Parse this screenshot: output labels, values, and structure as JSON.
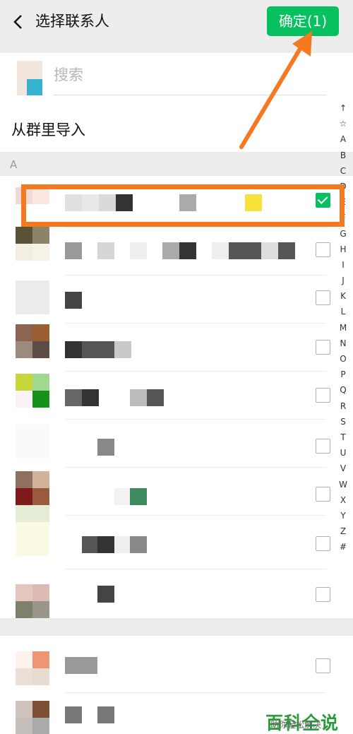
{
  "header": {
    "title": "选择联系人",
    "confirm_label": "确定(1)"
  },
  "search": {
    "placeholder": "搜索"
  },
  "import": {
    "label": "从群里导入"
  },
  "section": {
    "letter": "A"
  },
  "index_letters": [
    "↑",
    "☆",
    "A",
    "B",
    "C",
    "D",
    "E",
    "F",
    "G",
    "H",
    "I",
    "J",
    "K",
    "L",
    "M",
    "N",
    "O",
    "P",
    "Q",
    "R",
    "S",
    "T",
    "U",
    "V",
    "W",
    "X",
    "Y",
    "Z",
    "#"
  ],
  "contacts": [
    {
      "checked": true
    },
    {
      "checked": false
    },
    {
      "checked": false
    },
    {
      "checked": false
    },
    {
      "checked": false
    },
    {
      "checked": false
    },
    {
      "checked": false
    },
    {
      "checked": false
    },
    {
      "checked": false
    },
    {
      "checked": false
    },
    {
      "checked": false
    }
  ],
  "watermark": {
    "title": "百科全说",
    "subtitle": "助你轻松解决"
  },
  "colors": {
    "accent": "#07c160",
    "highlight": "#f47920"
  }
}
